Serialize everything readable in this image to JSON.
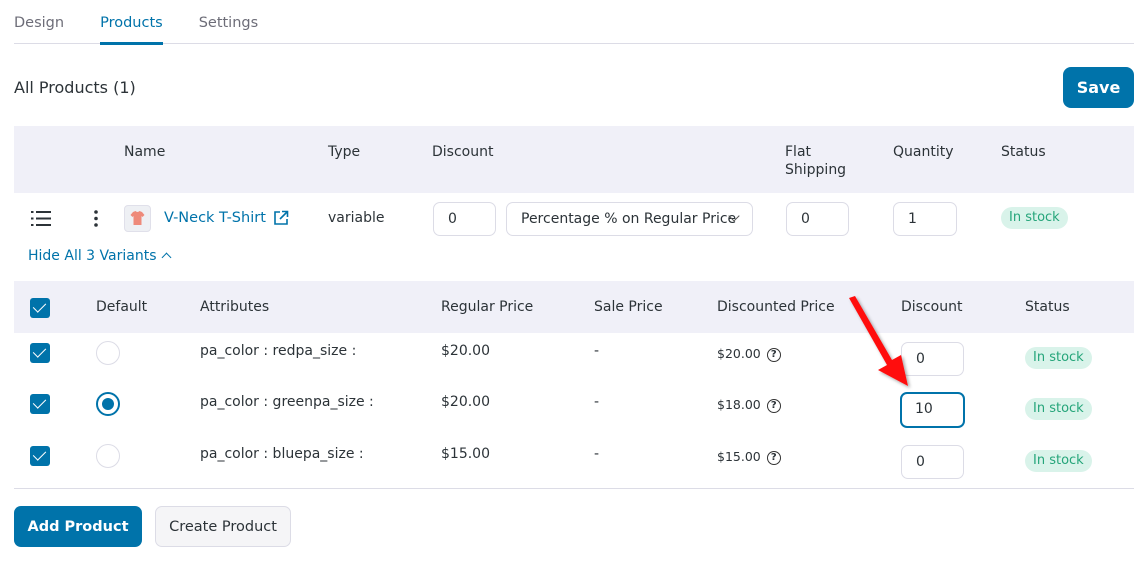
{
  "tabs": [
    {
      "label": "Design",
      "active": false
    },
    {
      "label": "Products",
      "active": true
    },
    {
      "label": "Settings",
      "active": false
    }
  ],
  "page_title": "All Products (1)",
  "save_label": "Save",
  "products_table": {
    "headers": {
      "name": "Name",
      "type": "Type",
      "discount": "Discount",
      "flat_shipping": "Flat Shipping",
      "quantity": "Quantity",
      "status": "Status"
    },
    "rows": [
      {
        "name": "V-Neck T-Shirt",
        "type": "variable",
        "discount_value": "0",
        "discount_type": "Percentage % on Regular Price",
        "flat_shipping": "0",
        "quantity": "1",
        "status": "In stock"
      }
    ]
  },
  "variants_toggle_label": "Hide All 3 Variants",
  "variants_table": {
    "headers": {
      "default": "Default",
      "attributes": "Attributes",
      "regular_price": "Regular Price",
      "sale_price": "Sale Price",
      "discounted_price": "Discounted Price",
      "discount": "Discount",
      "status": "Status"
    },
    "rows": [
      {
        "checked": true,
        "default": false,
        "attributes": "pa_color : redpa_size :",
        "regular_price": "$20.00",
        "sale_price": "-",
        "discounted_price": "$20.00",
        "discount": "0",
        "status": "In stock"
      },
      {
        "checked": true,
        "default": true,
        "attributes": "pa_color : greenpa_size :",
        "regular_price": "$20.00",
        "sale_price": "-",
        "discounted_price": "$18.00",
        "discount": "10",
        "status": "In stock"
      },
      {
        "checked": true,
        "default": false,
        "attributes": "pa_color : bluepa_size :",
        "regular_price": "$15.00",
        "sale_price": "-",
        "discounted_price": "$15.00",
        "discount": "0",
        "status": "In stock"
      }
    ]
  },
  "help_glyph": "?",
  "add_product_label": "Add Product",
  "create_product_label": "Create Product",
  "colors": {
    "accent": "#0073aa",
    "header_bg": "#f0f0f8",
    "badge_bg": "#d9f3ea",
    "badge_text": "#25a57a",
    "annotation_arrow": "#ff0000"
  }
}
